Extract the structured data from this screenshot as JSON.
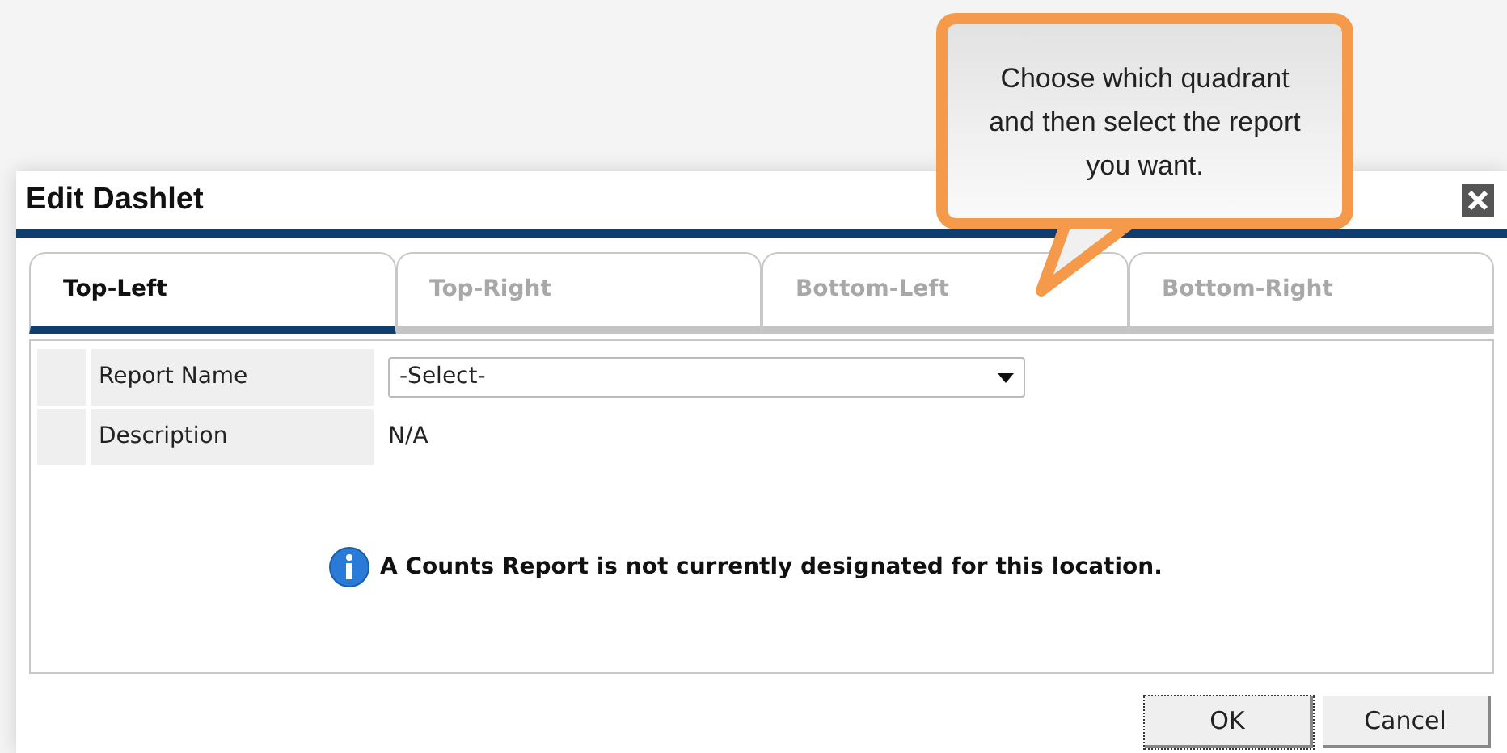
{
  "window": {
    "title": "Edit Dashlet"
  },
  "tabs": [
    {
      "label": "Top-Left",
      "selected": true
    },
    {
      "label": "Top-Right",
      "selected": false
    },
    {
      "label": "Bottom-Left",
      "selected": false
    },
    {
      "label": "Bottom-Right",
      "selected": false
    }
  ],
  "fields": [
    {
      "kind": "select",
      "label": "Report Name",
      "value": "-Select-"
    },
    {
      "kind": "text",
      "label": "Description",
      "value": "N/A"
    }
  ],
  "message": "A Counts Report is not currently designated for this location.",
  "buttons": [
    {
      "label": "OK",
      "focused": true
    },
    {
      "label": "Cancel",
      "focused": false
    }
  ],
  "callout": {
    "text": "Choose which quadrant and then select the report you want."
  }
}
